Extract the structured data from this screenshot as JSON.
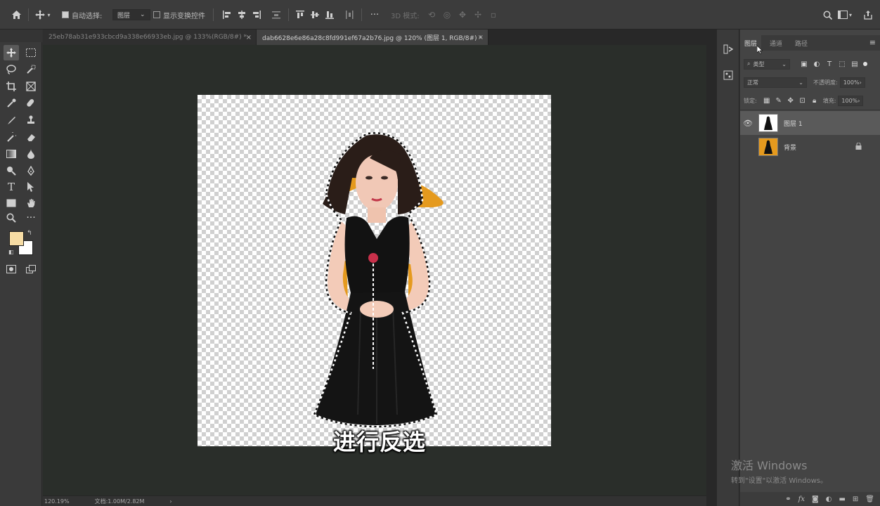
{
  "options_bar": {
    "auto_select_label": "自动选择:",
    "auto_select_value": "图层",
    "show_transform_label": "显示变换控件",
    "mode_3d_label": "3D 模式:",
    "icons": [
      "home-icon",
      "move-icon",
      "align-left-icon",
      "align-center-icon",
      "align-right-icon",
      "distribute-icon",
      "align-top-icon",
      "align-middle-icon",
      "align-bottom-icon",
      "more-icon",
      "search-icon",
      "workspace-icon",
      "share-icon"
    ]
  },
  "tabs": [
    {
      "label": "25eb78ab31e933cbcd9a338e66933eb.jpg @ 133%(RGB/8#) *",
      "active": false
    },
    {
      "label": "dab6628e6e86a28c8fd991ef67a2b76.jpg @ 120% (图层 1, RGB/8#) *",
      "active": true
    }
  ],
  "canvas": {
    "subtitle": "进行反选",
    "accent_orange": "#e59a1e"
  },
  "status_bar": {
    "zoom": "120.19%",
    "doc_info": "文档:1.00M/2.82M"
  },
  "layers_panel": {
    "tabs": [
      "图层",
      "通道",
      "路径"
    ],
    "filter_kind": "类型",
    "blend_mode": "正常",
    "opacity_label": "不透明度:",
    "opacity_value": "100%",
    "lock_label": "锁定:",
    "fill_label": "填充:",
    "fill_value": "100%",
    "layers": [
      {
        "name": "图层 1",
        "selected": true,
        "visible": true
      },
      {
        "name": "背景",
        "selected": false,
        "visible": false,
        "locked": true
      }
    ]
  },
  "watermark": {
    "line1": "激活 Windows",
    "line2": "转到\"设置\"以激活 Windows。"
  }
}
